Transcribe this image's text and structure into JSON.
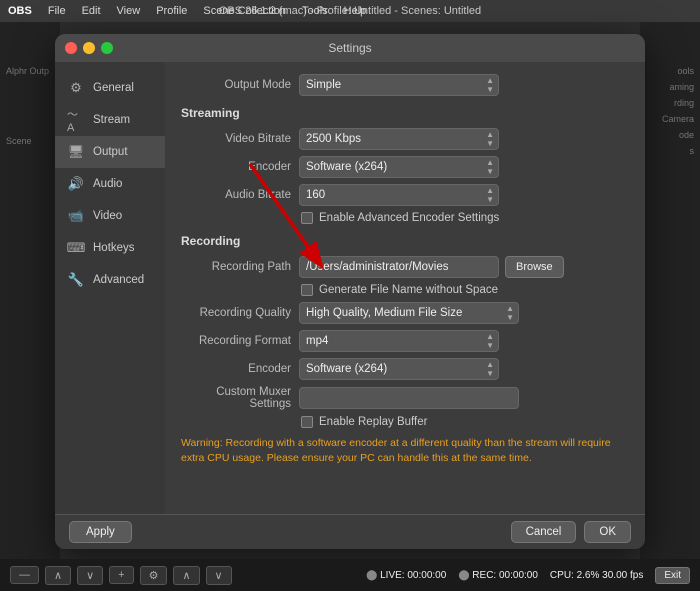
{
  "menubar": {
    "logo": "OBS",
    "items": [
      "File",
      "Edit",
      "View",
      "Profile",
      "Scene Collection",
      "Tools",
      "Help"
    ],
    "title": "OBS 26.1.2 (mac) - Profile: Untitled - Scenes: Untitled"
  },
  "settings_window": {
    "title": "Settings",
    "traffic_lights": [
      "red",
      "yellow",
      "green"
    ]
  },
  "sidebar": {
    "items": [
      {
        "id": "general",
        "label": "General",
        "icon": "⚙"
      },
      {
        "id": "stream",
        "label": "Stream",
        "icon": "📡"
      },
      {
        "id": "output",
        "label": "Output",
        "icon": "🖥"
      },
      {
        "id": "audio",
        "label": "Audio",
        "icon": "🔊"
      },
      {
        "id": "video",
        "label": "Video",
        "icon": "📹"
      },
      {
        "id": "hotkeys",
        "label": "Hotkeys",
        "icon": "⌨"
      },
      {
        "id": "advanced",
        "label": "Advanced",
        "icon": "🔧"
      }
    ]
  },
  "content": {
    "output_mode_label": "Output Mode",
    "output_mode_value": "Simple",
    "streaming_section": "Streaming",
    "video_bitrate_label": "Video Bitrate",
    "video_bitrate_value": "2500 Kbps",
    "encoder_label": "Encoder",
    "encoder_value": "Software (x264)",
    "audio_bitrate_label": "Audio Bitrate",
    "audio_bitrate_value": "160",
    "enable_advanced_label": "Enable Advanced Encoder Settings",
    "recording_section": "Recording",
    "recording_path_label": "Recording Path",
    "recording_path_value": "/Users/administrator/Movies",
    "browse_label": "Browse",
    "generate_filename_label": "Generate File Name without Space",
    "recording_quality_label": "Recording Quality",
    "recording_quality_value": "High Quality, Medium File Size",
    "recording_format_label": "Recording Format",
    "recording_format_value": "mp4",
    "recording_encoder_label": "Encoder",
    "recording_encoder_value": "Software (x264)",
    "custom_muxer_label": "Custom Muxer Settings",
    "enable_replay_label": "Enable Replay Buffer",
    "warning_text": "Warning: Recording with a software encoder at a different quality than the stream will require extra CPU usage. Please ensure your PC can handle this at the same time."
  },
  "buttons": {
    "apply": "Apply",
    "cancel": "Cancel",
    "ok": "OK"
  },
  "statusbar": {
    "live_label": "LIVE:",
    "live_time": "00:00:00",
    "rec_label": "REC:",
    "rec_time": "00:00:00",
    "cpu": "CPU: 2.6%",
    "fps": "30.00 fps",
    "exit_label": "Exit"
  },
  "bg_left": {
    "items": [
      "Alphr Outp",
      "Scene"
    ]
  },
  "bg_right": {
    "items": [
      "ools",
      "aming",
      "rding",
      "Camera",
      "ode",
      "s"
    ]
  }
}
